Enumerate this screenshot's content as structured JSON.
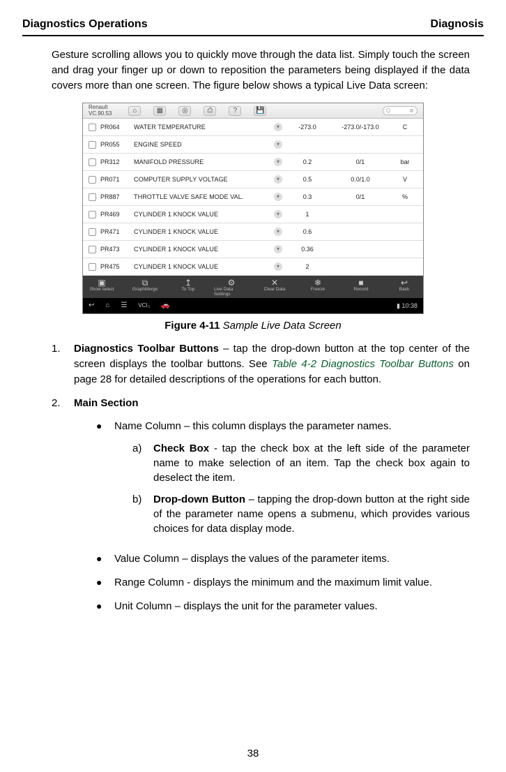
{
  "header": {
    "left": "Diagnostics Operations",
    "right": "Diagnosis"
  },
  "intro": "Gesture scrolling allows you to quickly move through the data list. Simply touch the screen and drag your finger up or down to reposition the parameters being displayed if the data covers more than one screen. The figure below shows a typical Live Data screen:",
  "figure": {
    "brand_line1": "Renault",
    "brand_line2": "VC.90.53",
    "search_placeholder": "Q",
    "fnbar": [
      {
        "icon": "▣",
        "label": "Show select"
      },
      {
        "icon": "⧉",
        "label": "GraphMerge"
      },
      {
        "icon": "↥",
        "label": "To Top"
      },
      {
        "icon": "⚙",
        "label": "Live Data Settings"
      },
      {
        "icon": "✕",
        "label": "Clear Data"
      },
      {
        "icon": "❄",
        "label": "Freeze"
      },
      {
        "icon": "■",
        "label": "Record"
      },
      {
        "icon": "↩",
        "label": "Back"
      }
    ],
    "time": "▮ 10:38",
    "rows": [
      {
        "code": "PR064",
        "name": "WATER TEMPERATURE",
        "val": "-273.0",
        "range": "-273.0/-173.0",
        "unit": "C"
      },
      {
        "code": "PR055",
        "name": "ENGINE SPEED",
        "val": "",
        "range": "",
        "unit": ""
      },
      {
        "code": "PR312",
        "name": "MANIFOLD PRESSURE",
        "val": "0.2",
        "range": "0/1",
        "unit": "bar"
      },
      {
        "code": "PR071",
        "name": "COMPUTER SUPPLY VOLTAGE",
        "val": "0.5",
        "range": "0.0/1.0",
        "unit": "V"
      },
      {
        "code": "PR887",
        "name": "THROTTLE VALVE SAFE MODE VAL.",
        "val": "0.3",
        "range": "0/1",
        "unit": "%"
      },
      {
        "code": "PR469",
        "name": "CYLINDER 1 KNOCK VALUE",
        "val": "1",
        "range": "",
        "unit": ""
      },
      {
        "code": "PR471",
        "name": "CYLINDER 1 KNOCK VALUE",
        "val": "0.6",
        "range": "",
        "unit": ""
      },
      {
        "code": "PR473",
        "name": "CYLINDER 1 KNOCK VALUE",
        "val": "0.36",
        "range": "",
        "unit": ""
      },
      {
        "code": "PR475",
        "name": "CYLINDER 1 KNOCK VALUE",
        "val": "2",
        "range": "",
        "unit": ""
      }
    ]
  },
  "caption": {
    "label": "Figure 4-11",
    "text": "Sample Live Data Screen"
  },
  "list": {
    "item1": {
      "num": "1.",
      "lead": "Diagnostics Toolbar Buttons",
      "rest_a": " – tap the drop-down button at the top center of the screen displays the toolbar buttons. See ",
      "xref": "Table 4-2 Diagnostics Toolbar Buttons",
      "rest_b": " on page 28 for detailed descriptions of the operations for each button."
    },
    "item2": {
      "num": "2.",
      "lead": "Main Section",
      "bullets": {
        "b1": {
          "text": "Name Column – this column displays the parameter names.",
          "letters": {
            "a": {
              "lbl": "a)",
              "lead": "Check Box",
              "rest": " - tap the check box at the left side of the parameter name to make selection of an item. Tap the check box again to deselect the item."
            },
            "b": {
              "lbl": "b)",
              "lead": "Drop-down Button",
              "rest": " – tapping the drop-down button at the right side of the parameter name opens a submenu, which provides various choices for data display mode."
            }
          }
        },
        "b2": "Value Column – displays the values of the parameter items.",
        "b3": "Range Column - displays the minimum and the maximum limit value.",
        "b4": "Unit Column – displays the unit for the parameter values."
      }
    }
  },
  "pagenum": "38"
}
